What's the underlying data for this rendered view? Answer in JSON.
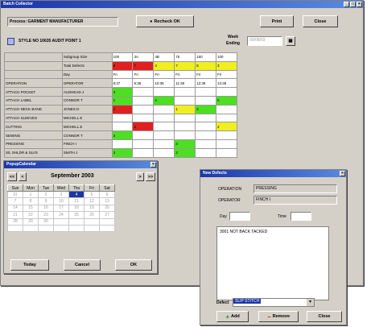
{
  "main": {
    "title": "Batch Collector",
    "process_label": "Process",
    "process_value": "GARMENT MANUFACTURER",
    "recheck_label": "Recheck OK",
    "print_label": "Print",
    "close_label": "Close",
    "style_text": "STYLE NO 10635 AUDIT POINT 1",
    "week_label": "Week",
    "ending_label": "Ending",
    "week_value": "09/08/03"
  },
  "grid": {
    "header_rows": [
      {
        "label": "Subgroup Size",
        "values": [
          "100",
          "3A",
          "4B",
          "75",
          "150",
          "100"
        ]
      },
      {
        "label": "Total Defects",
        "values": [
          "9",
          "7",
          "4",
          "7",
          "8",
          "3"
        ]
      },
      {
        "label": "Day",
        "values": [
          "Fri",
          "Fri",
          "Fri",
          "Fri",
          "Fri",
          "Fri"
        ]
      }
    ],
    "operation_header": {
      "op": "OPERATION",
      "operator": "OPERATOR",
      "times": [
        "8:37",
        "9:38",
        "10:38",
        "11:38",
        "12:38",
        "13:38"
      ]
    },
    "rows": [
      {
        "op": "ATTACH POCKET",
        "operator": "AUSHEAD J",
        "cells": [
          "3",
          "",
          "",
          "",
          "",
          ""
        ]
      },
      {
        "op": "ATTACH LABEL",
        "operator": "CONNOR T",
        "cells": [
          "1",
          "",
          "4",
          "",
          "",
          "5"
        ]
      },
      {
        "op": "ATTACH NECK BAND",
        "operator": "JONES D",
        "cells": [
          "2",
          "",
          "",
          "1",
          "3",
          ""
        ]
      },
      {
        "op": "ATTACH SLEEVES",
        "operator": "MICHELL E",
        "cells": [
          "",
          "",
          "",
          "",
          "",
          ""
        ]
      },
      {
        "op": "CUTTING",
        "operator": "MICHELL E",
        "cells": [
          "",
          "2",
          "",
          "",
          "",
          "2"
        ]
      },
      {
        "op": "SEWING",
        "operator": "CONNOR T",
        "cells": [
          "3",
          "",
          "",
          "",
          "",
          ""
        ]
      },
      {
        "op": "PRESSING",
        "operator": "FINCH I",
        "cells": [
          "",
          "",
          "",
          "3",
          "",
          ""
        ]
      },
      {
        "op": "S/L SHLDR & SLVS",
        "operator": "SMITH J",
        "cells": [
          "3",
          "",
          "",
          "3",
          "",
          ""
        ]
      }
    ],
    "colors": {
      "red": "#e02020",
      "green": "#4ce020",
      "yellow": "#f0ee20"
    }
  },
  "calendar": {
    "title": "PopupCalendar",
    "nav_prev_prev": "<<",
    "nav_prev": "<",
    "nav_next": ">",
    "nav_next_next": ">>",
    "month_year": "September 2003",
    "weekdays": [
      "Sun",
      "Mon",
      "Tue",
      "Wed",
      "Thu",
      "Fri",
      "Sat"
    ],
    "weeks": [
      [
        "31",
        "1",
        "2",
        "3",
        "4",
        "5",
        "6"
      ],
      [
        "7",
        "8",
        "9",
        "10",
        "11",
        "12",
        "13"
      ],
      [
        "14",
        "15",
        "16",
        "17",
        "18",
        "19",
        "20"
      ],
      [
        "21",
        "22",
        "23",
        "24",
        "25",
        "26",
        "27"
      ],
      [
        "28",
        "29",
        "30",
        "",
        "",
        "",
        ""
      ],
      [
        "",
        "",
        "",
        "",
        "",
        "",
        ""
      ]
    ],
    "selected": "4",
    "today_label": "Today",
    "cancel_label": "Cancel",
    "ok_label": "OK"
  },
  "defects": {
    "title": "New Defects",
    "operation_label": "OPERATION",
    "operation_value": "PRESSING",
    "operator_label": "OPERATOR",
    "operator_value": "FINCH I",
    "day_label": "Day",
    "time_label": "Time",
    "defect_list_item": "3001 NOT BACK TACKED",
    "defect_label": "Defect",
    "defect_value": "SLIP STITCH",
    "add_label": "Add",
    "remove_label": "Remove",
    "close_label": "Close"
  }
}
